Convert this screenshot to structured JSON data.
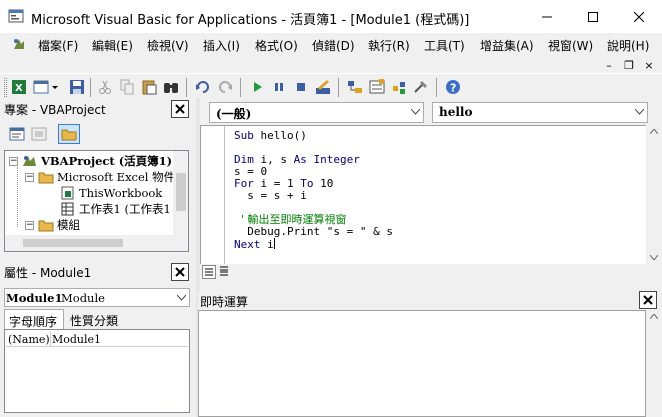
{
  "window": {
    "title": "Microsoft Visual Basic for Applications - 活頁簿1 - [Module1 (程式碼)]",
    "minimize_icon": "minimize-icon",
    "maximize_icon": "maximize-icon",
    "close_icon": "close-icon"
  },
  "menubar": {
    "items": [
      "檔案(F)",
      "編輯(E)",
      "檢視(V)",
      "插入(I)",
      "格式(O)",
      "偵錯(D)",
      "執行(R)",
      "工具(T)",
      "增益集(A)",
      "視窗(W)",
      "說明(H)"
    ],
    "mdi_minimize": "–",
    "mdi_restore": "❐",
    "mdi_close": "×"
  },
  "toolbar": {
    "icons": [
      "view-excel-icon",
      "insert-module-icon",
      "save-icon",
      "cut-icon",
      "copy-icon",
      "paste-icon",
      "find-icon",
      "undo-icon",
      "redo-icon",
      "run-icon",
      "break-icon",
      "reset-icon",
      "design-mode-icon",
      "project-explorer-icon",
      "properties-icon",
      "object-browser-icon",
      "toolbox-icon",
      "help-icon"
    ]
  },
  "project_panel": {
    "title": "專案 - VBAProject",
    "tree": [
      {
        "label": "VBAProject (活頁簿1)",
        "bold": true,
        "expand": "−"
      },
      {
        "label": "Microsoft Excel 物件",
        "bold": false,
        "expand": "−"
      },
      {
        "label": "ThisWorkbook",
        "bold": false,
        "expand": ""
      },
      {
        "label": "工作表1 (工作表1",
        "bold": false,
        "expand": ""
      },
      {
        "label": "模組",
        "bold": false,
        "expand": "−"
      }
    ]
  },
  "properties_panel": {
    "title": "屬性 - Module1",
    "object_name": "Module1",
    "object_type": "Module",
    "tabs": [
      "字母順序",
      "性質分類"
    ],
    "rows": [
      {
        "name": "(Name)",
        "value": "Module1"
      }
    ]
  },
  "code_window": {
    "object_combo": "(一般)",
    "proc_combo": "hello",
    "lines": [
      "Sub hello()",
      "",
      "Dim i, s As Integer",
      "s = 0",
      "For i = 1 To 10",
      "  s = s + i",
      "",
      "  ' 輸出至即時運算視窗",
      "  Debug.Print \"s = \" & s",
      "Next i"
    ]
  },
  "immediate_window": {
    "title": "即時運算"
  },
  "colors": {
    "keyword": "#00007f",
    "comment": "#008000",
    "panel_bg": "#f0f0f0"
  }
}
